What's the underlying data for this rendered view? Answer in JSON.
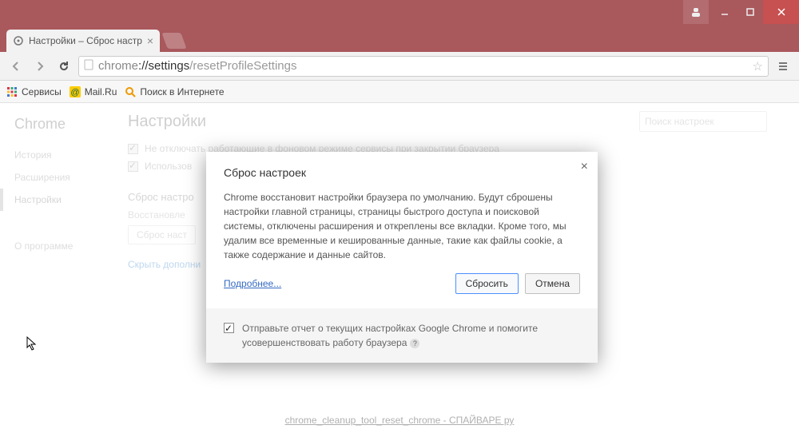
{
  "window": {
    "tab_title": "Настройки – Сброс настр",
    "url_scheme": "chrome",
    "url_host": "://settings",
    "url_path": "/resetProfileSettings"
  },
  "bookmarks": {
    "items": [
      "Сервисы",
      "Mail.Ru",
      "Поиск в Интернете"
    ]
  },
  "sidebar": {
    "brand": "Chrome",
    "items": [
      "История",
      "Расширения",
      "Настройки",
      "О программе"
    ],
    "selected_index": 2
  },
  "settings": {
    "heading": "Настройки",
    "search_placeholder": "Поиск настроек",
    "check1": "Не отключать работающие в фоновом режиме сервисы при закрытии браузера",
    "check2_prefix": "Использов",
    "section_title": "Сброс настро",
    "restore_label": "Восстановле",
    "reset_button": "Сброс наст",
    "hide_link": "Скрыть дополни"
  },
  "modal": {
    "title": "Сброс настроек",
    "body": "Chrome восстановит настройки браузера по умолчанию. Будут сброшены настройки главной страницы, страницы быстрого доступа и поисковой системы, отключены расширения и откреплены все вкладки. Кроме того, мы удалим все временные и кешированные данные, такие как файлы cookie, а также содержание и данные сайтов.",
    "learn_more": "Подробнее...",
    "reset_btn": "Сбросить",
    "cancel_btn": "Отмена",
    "report_label": "Отправьте отчет о текущих настройках Google Chrome и помогите усовершенствовать работу браузера",
    "report_checked": true
  },
  "caption": "chrome_cleanup_tool_reset_chrome - СПАЙВАРЕ ру"
}
